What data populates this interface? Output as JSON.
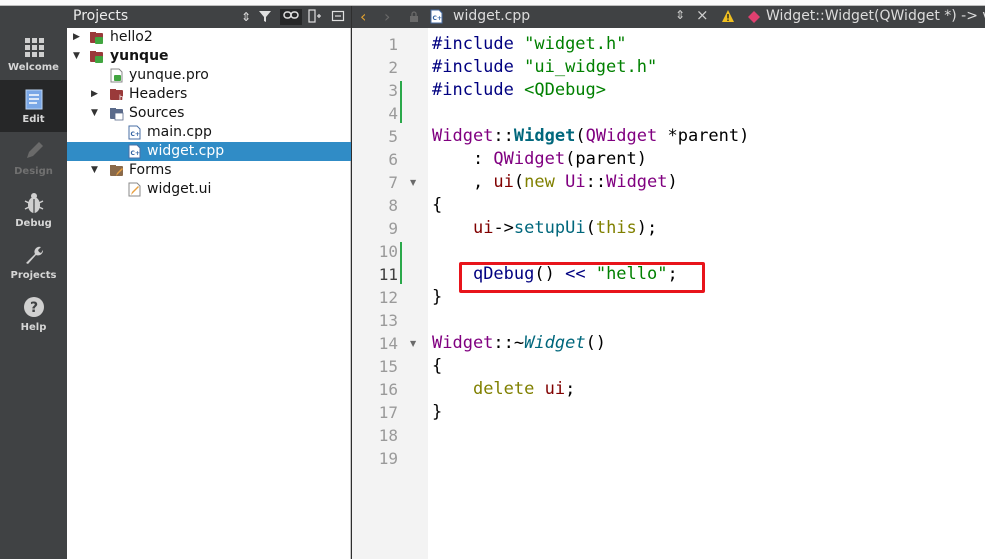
{
  "modes": [
    {
      "label": "Welcome",
      "icon": "grid-icon",
      "state": "normal"
    },
    {
      "label": "Edit",
      "icon": "edit-document-icon",
      "state": "active"
    },
    {
      "label": "Design",
      "icon": "pencil-icon",
      "state": "disabled"
    },
    {
      "label": "Debug",
      "icon": "bug-icon",
      "state": "normal"
    },
    {
      "label": "Projects",
      "icon": "wrench-icon",
      "state": "normal"
    },
    {
      "label": "Help",
      "icon": "help-icon",
      "state": "normal"
    }
  ],
  "projects_pane": {
    "title": "Projects",
    "tree": [
      {
        "label": "hello2",
        "expanded": false,
        "bold": false
      },
      {
        "label": "yunque",
        "expanded": true,
        "bold": true
      },
      {
        "label": "yunque.pro"
      },
      {
        "label": "Headers",
        "expanded": false
      },
      {
        "label": "Sources",
        "expanded": true
      },
      {
        "label": "main.cpp"
      },
      {
        "label": "widget.cpp",
        "selected": true
      },
      {
        "label": "Forms",
        "expanded": true
      },
      {
        "label": "widget.ui"
      }
    ]
  },
  "editor": {
    "file_name": "widget.cpp",
    "function_context": "Widget::Widget(QWidget *) -> vo",
    "current_line": 11,
    "line_numbers": [
      "1",
      "2",
      "3",
      "4",
      "5",
      "6",
      "7",
      "8",
      "9",
      "10",
      "11",
      "12",
      "13",
      "14",
      "15",
      "16",
      "17",
      "18",
      "19"
    ],
    "lines": {
      "l1": {
        "a": "#include ",
        "b": "\"widget.h\""
      },
      "l2": {
        "a": "#include ",
        "b": "\"ui_widget.h\""
      },
      "l3": {
        "a": "#include ",
        "b": "<QDebug>"
      },
      "l5": {
        "a": "Widget",
        "b": "::",
        "c": "Widget",
        "d": "(",
        "e": "QWidget",
        "f": " *",
        "g": "parent",
        "h": ")"
      },
      "l6": {
        "a": "    : ",
        "b": "QWidget",
        "c": "(",
        "d": "parent",
        "e": ")"
      },
      "l7": {
        "a": "    , ",
        "b": "ui",
        "c": "(",
        "d": "new",
        "e": " ",
        "f": "Ui",
        "g": "::",
        "h": "Widget",
        "i": ")"
      },
      "l8": {
        "a": "{"
      },
      "l9": {
        "a": "    ",
        "b": "ui",
        "c": "->",
        "d": "setupUi",
        "e": "(",
        "f": "this",
        "g": ");"
      },
      "l11": {
        "a": "    ",
        "b": "qDebug",
        "c": "() ",
        "d": "<<",
        "e": " ",
        "f": "\"hello\"",
        "g": ";"
      },
      "l12": {
        "a": "}"
      },
      "l14": {
        "a": "Widget",
        "b": "::~",
        "c": "Widget",
        "d": "()"
      },
      "l15": {
        "a": "{"
      },
      "l16": {
        "a": "    ",
        "b": "delete",
        "c": " ",
        "d": "ui",
        "e": ";"
      },
      "l17": {
        "a": "}"
      }
    }
  },
  "colors": {
    "accent_selection": "#308cc6",
    "highlight_box": "#e8141b",
    "change_marker": "#2aa84a"
  }
}
